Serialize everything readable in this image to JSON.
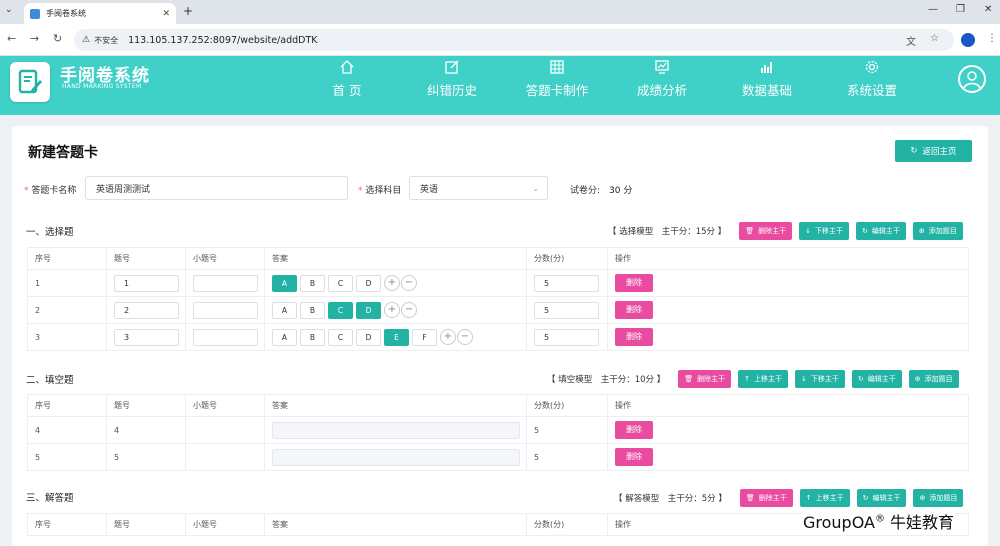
{
  "browser": {
    "tab_title": "手阅卷系统",
    "not_secure": "不安全",
    "url": "113.105.137.252:8097/website/addDTK"
  },
  "header": {
    "logo_title": "手阅卷系统",
    "logo_subtitle": "HAND MARKING SYSTEM",
    "nav": [
      {
        "label": "首 页",
        "icon": "home-icon"
      },
      {
        "label": "纠错历史",
        "icon": "edit-icon"
      },
      {
        "label": "答题卡制作",
        "icon": "grid-icon"
      },
      {
        "label": "成绩分析",
        "icon": "monitor-chart-icon"
      },
      {
        "label": "数据基础",
        "icon": "bar-chart-icon"
      },
      {
        "label": "系统设置",
        "icon": "gear-icon"
      }
    ]
  },
  "page": {
    "title": "新建答题卡",
    "back_button": "返回主页"
  },
  "form": {
    "required_mark": "*",
    "name_label": "答题卡名称",
    "name_value": "英语周测测试",
    "subject_label": "选择科目",
    "subject_value": "英语",
    "score_label": "试卷分:",
    "score_value": "30 分"
  },
  "columns": {
    "seq": "序号",
    "qno": "题号",
    "subno": "小题号",
    "answer": "答案",
    "score": "分数(分)",
    "ops": "操作"
  },
  "buttons": {
    "delete_stem": "删除主干",
    "move_up": "上移主干",
    "move_down": "下移主干",
    "edit_stem": "编辑主干",
    "add_question": "添加题目",
    "delete": "删除"
  },
  "sections": [
    {
      "title": "一、选择题",
      "info": "【 选择模型　主干分：15分 】",
      "rows": [
        {
          "seq": "1",
          "qno": "1",
          "options": [
            "A",
            "B",
            "C",
            "D"
          ],
          "selected": [
            "A"
          ],
          "score": "5"
        },
        {
          "seq": "2",
          "qno": "2",
          "options": [
            "A",
            "B",
            "C",
            "D"
          ],
          "selected": [
            "C",
            "D"
          ],
          "score": "5"
        },
        {
          "seq": "3",
          "qno": "3",
          "options": [
            "A",
            "B",
            "C",
            "D",
            "E",
            "F"
          ],
          "selected": [
            "E"
          ],
          "score": "5"
        }
      ]
    },
    {
      "title": "二、填空题",
      "info": "【 填空模型　主干分：10分 】",
      "rows": [
        {
          "seq": "4",
          "qno": "4",
          "score": "5"
        },
        {
          "seq": "5",
          "qno": "5",
          "score": "5"
        }
      ]
    },
    {
      "title": "三、解答题",
      "info": "【 解答模型　主干分：5分 】"
    }
  ],
  "watermark": {
    "text": "GroupOA",
    "reg": "®",
    "cn": " 牛娃教育"
  },
  "colors": {
    "header": "#3fd0c8",
    "accent": "#22b3a5",
    "danger": "#e84b9f"
  }
}
